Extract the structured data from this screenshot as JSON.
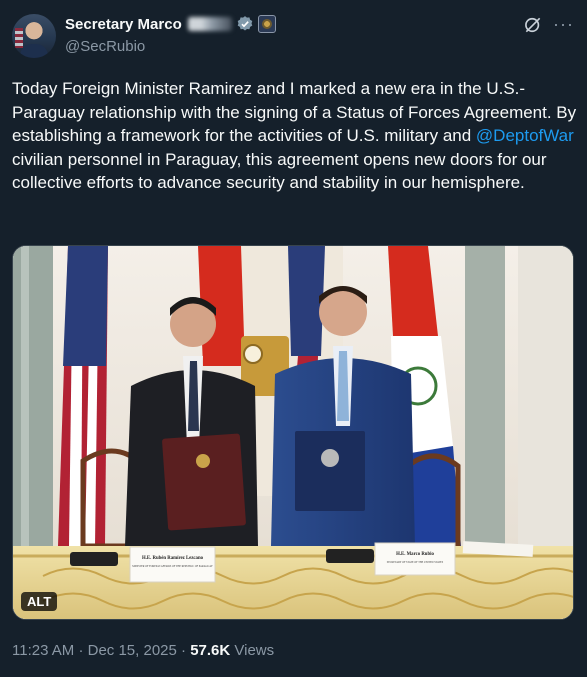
{
  "author": {
    "display_name": "Secretary Marco",
    "handle": "@SecRubio"
  },
  "tweet": {
    "text_before": "Today Foreign Minister Ramirez and I marked a new era in the U.S.-Paraguay relationship with the signing of a Status of Forces Agreement. By establishing a framework for the activities of U.S. military and ",
    "mention": "@DeptofWar",
    "text_after": " civilian personnel in Paraguay, this agreement opens new doors for our collective efforts to advance security and stability in our hemisphere."
  },
  "media": {
    "alt_label": "ALT",
    "placard_left_name": "H.E. Rubén Ramírez Lezcano",
    "placard_left_title": "MINISTER OF FOREIGN AFFAIRS OF THE REPUBLIC OF PARAGUAY",
    "placard_right_name": "H.E. Marco Rubio",
    "placard_right_title": "SECRETARY OF STATE OF THE UNITED STATES"
  },
  "meta": {
    "time": "11:23 AM",
    "date": "Dec 15, 2025",
    "separator": "·",
    "views_count": "57.6K",
    "views_label": "Views"
  },
  "icons": {
    "verified": "verified-badge-icon",
    "affiliate": "government-seal-icon",
    "grok": "grok-icon",
    "more": "more-horizontal-icon"
  },
  "colors": {
    "background": "#15202b",
    "text": "#f7f9f9",
    "secondary": "#8b98a5",
    "link": "#1d9bf0"
  }
}
